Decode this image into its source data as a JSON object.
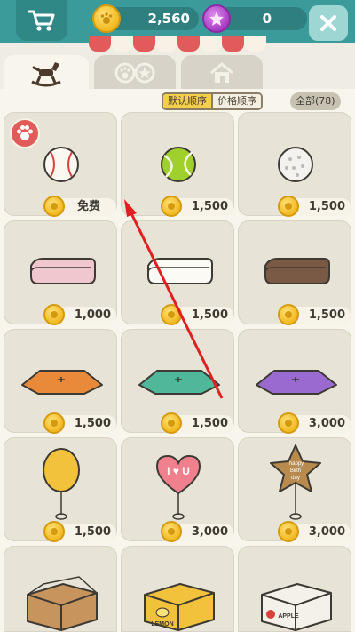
{
  "header": {
    "coins": "2,560",
    "gems": "0",
    "cart_icon": "cart-icon",
    "close_icon": "close-icon"
  },
  "tabs": [
    {
      "name": "rocking-horse-icon",
      "active": true
    },
    {
      "name": "paw-star-icon",
      "active": false
    },
    {
      "name": "house-icon",
      "active": false
    }
  ],
  "sort": {
    "default": "默认顺序",
    "price": "价格顺序",
    "all": "全部(78)"
  },
  "items": [
    {
      "icon": "baseball-icon",
      "price": "免费"
    },
    {
      "icon": "tennis-ball-icon",
      "price": "1,500"
    },
    {
      "icon": "white-ball-icon",
      "price": "1,500"
    },
    {
      "icon": "pink-blanket-icon",
      "price": "1,000"
    },
    {
      "icon": "white-blanket-icon",
      "price": "1,500"
    },
    {
      "icon": "brown-blanket-icon",
      "price": "1,500"
    },
    {
      "icon": "orange-cushion-icon",
      "price": "1,500"
    },
    {
      "icon": "teal-cushion-icon",
      "price": "1,500"
    },
    {
      "icon": "purple-cushion-icon",
      "price": "3,000"
    },
    {
      "icon": "yellow-balloon-icon",
      "price": "1,500"
    },
    {
      "icon": "heart-balloon-icon",
      "price": "3,000"
    },
    {
      "icon": "star-balloon-icon",
      "price": "3,000"
    },
    {
      "icon": "cardboard-box-icon",
      "price": ""
    },
    {
      "icon": "lemon-box-icon",
      "price": ""
    },
    {
      "icon": "apple-box-icon",
      "price": ""
    }
  ],
  "item_text": {
    "heart_balloon": "I ♥ U",
    "star_balloon": [
      "happy",
      "Birth",
      "day"
    ],
    "lemon_box": "LEMON",
    "apple_box": "APPLE"
  },
  "colors": {
    "header": "#3a9b9a",
    "coin": "#f2b81f",
    "gem": "#a83cc2",
    "active_sort": "#f5cf4a",
    "arrow": "#e02020"
  }
}
